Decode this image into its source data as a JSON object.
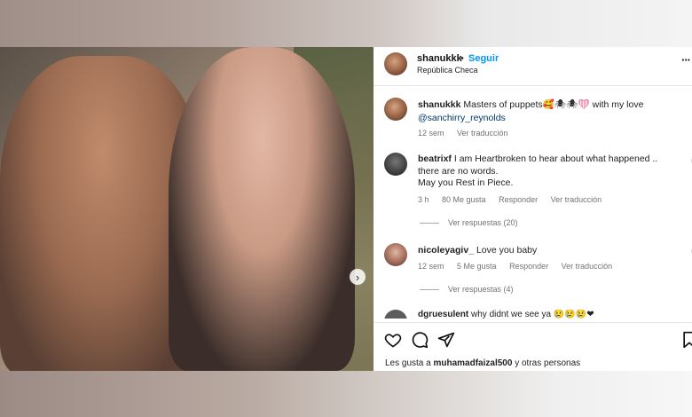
{
  "post": {
    "username": "shanukkk",
    "separator": "•",
    "follow_label": "Seguir",
    "location": "República Checa",
    "more_label": "···"
  },
  "caption": {
    "username": "shanukkk",
    "text": "Masters of puppets",
    "emojis": "🥰🕷🕷",
    "heart": "❤",
    "text_after": "with my love",
    "mention": "@sanchirry_reynolds",
    "time": "12 sem",
    "translate": "Ver traducción"
  },
  "comments": [
    {
      "username": "beatrixf",
      "line1": "I am Heartbroken to hear about what happened ..",
      "line2": "there are no words.",
      "line3": "May you Rest in Piece.",
      "time": "3 h",
      "likes": "80 Me gusta",
      "reply": "Responder",
      "translate": "Ver traducción",
      "view_replies": "Ver respuestas (20)"
    },
    {
      "username": "nicoleyagiv_",
      "line1": "Love you baby",
      "time": "12 sem",
      "likes": "5 Me gusta",
      "reply": "Responder",
      "translate": "Ver traducción",
      "view_replies": "Ver respuestas (4)"
    }
  ],
  "partial_comment": {
    "username": "dgruesulent",
    "text": "why didnt we see ya",
    "emojis": "😢😢😢❤"
  },
  "footer": {
    "likes_prefix": "Les gusta a",
    "likes_user": "muhamadfaizal500",
    "likes_suffix": "y otras personas"
  },
  "icons": {
    "like": "heart-outline-icon",
    "comment": "comment-bubble-icon",
    "share": "paper-plane-icon",
    "save": "bookmark-icon",
    "next": "chevron-right-icon"
  },
  "colors": {
    "follow": "#0095f6",
    "mention": "#00376b",
    "meta": "#737373",
    "heart": "#e0245e"
  }
}
